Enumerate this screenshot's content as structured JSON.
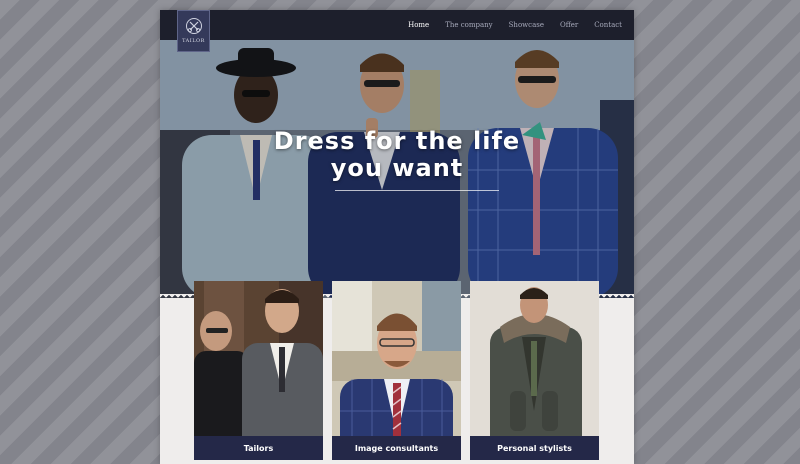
{
  "brand": {
    "logo_text": "TAILOR"
  },
  "nav": {
    "items": [
      {
        "label": "Home",
        "active": true
      },
      {
        "label": "The company"
      },
      {
        "label": "Showcase"
      },
      {
        "label": "Offer"
      },
      {
        "label": "Contact"
      }
    ]
  },
  "hero": {
    "title_line1": "Dress for the life",
    "title_line2": "you want"
  },
  "cards": [
    {
      "label": "Tailors"
    },
    {
      "label": "Image consultants"
    },
    {
      "label": "Personal stylists"
    }
  ],
  "colors": {
    "navbar": "#1d1f2c",
    "logo": "#34395a",
    "card_label": "#242848",
    "page_bg": "#efedec"
  }
}
